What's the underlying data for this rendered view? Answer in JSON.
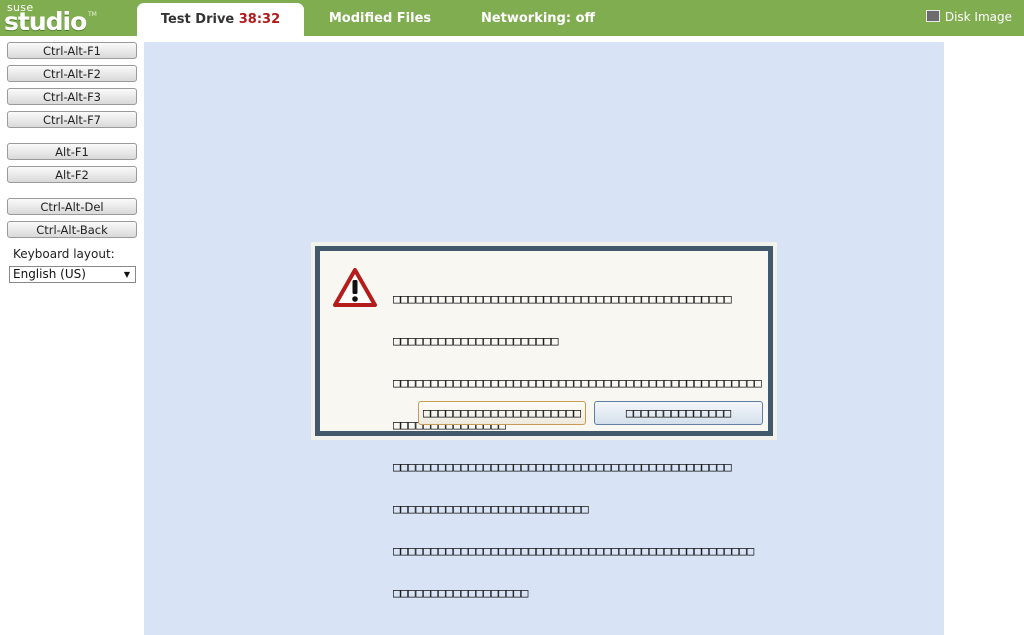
{
  "header": {
    "logo_top": "suse",
    "logo_main": "studio",
    "logo_tm": "TM",
    "tabs": [
      {
        "label": "Test Drive",
        "timer": "38:32"
      },
      {
        "label": "Modified Files"
      },
      {
        "label": "Networking: off"
      }
    ],
    "disk_image_label": "Disk Image"
  },
  "sidebar": {
    "buttons": [
      "Ctrl-Alt-F1",
      "Ctrl-Alt-F2",
      "Ctrl-Alt-F3",
      "Ctrl-Alt-F7",
      "Alt-F1",
      "Alt-F2",
      "Ctrl-Alt-Del",
      "Ctrl-Alt-Back"
    ],
    "keyboard_label": "Keyboard layout:",
    "keyboard_value": "English (US)"
  },
  "dialog": {
    "message_lines": [
      "□□□□□□□□□□□□□□□□□□□□□□□□□□□□□□□□□□□□□□□□□□□□□",
      "□□□□□□□□□□□□□□□□□□□□□□",
      "□□□□□□□□□□□□□□□□□□□□□□□□□□□□□□□□□□□□□□□□□□□□□□□□□",
      "□□□□□□□□□□□□□□□",
      "□□□□□□□□□□□□□□□□□□□□□□□□□□□□□□□□□□□□□□□□□□□□□",
      "□□□□□□□□□□□□□□□□□□□□□□□□□□",
      "□□□□□□□□□□□□□□□□□□□□□□□□□□□□□□□□□□□□□□□□□□□□□□□□",
      "□□□□□□□□□□□□□□□□□□"
    ],
    "button_1": "□□□□□□□□□□□□□□□□□□□□□",
    "button_2": "□□□□□□□□□□□□□□",
    "icon": "warning-icon"
  },
  "colors": {
    "header_bg": "#80ad50",
    "screen_bg": "#d8e4f6",
    "timer": "#b11a1a",
    "dialog_border": "#42586b"
  }
}
